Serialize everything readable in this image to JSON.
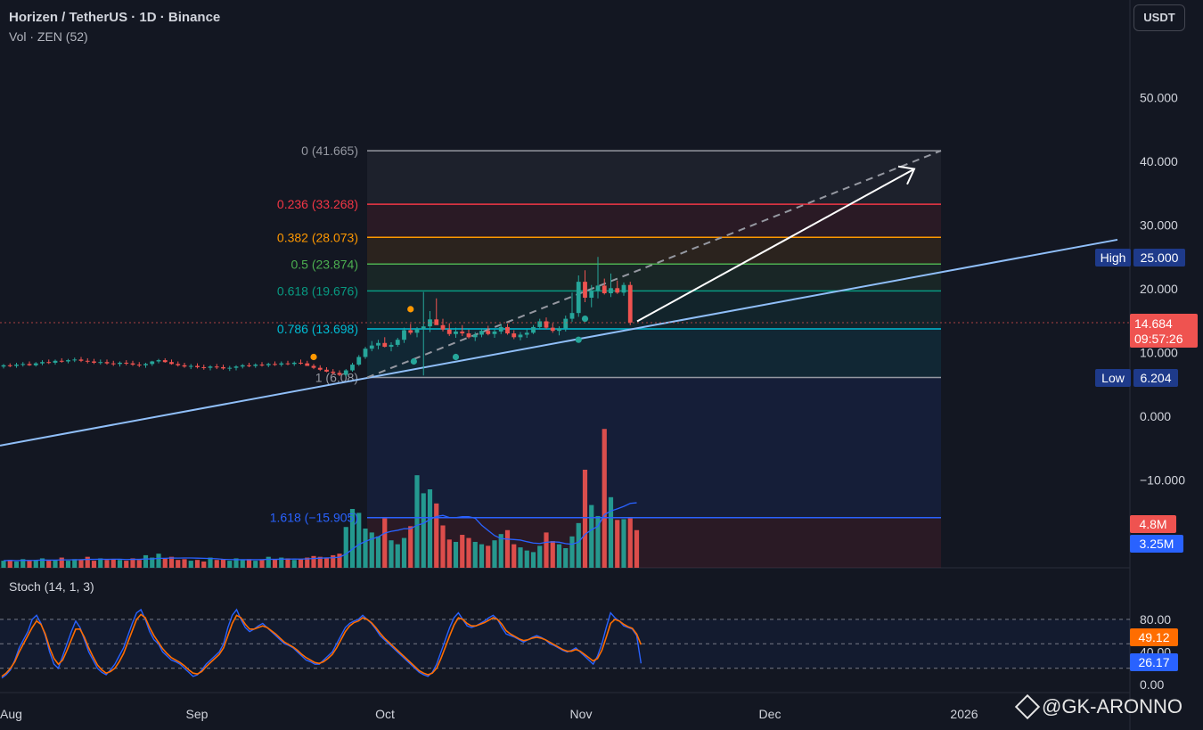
{
  "header": {
    "symbol_title": "Horizen / TetherUS · 1D · Binance",
    "volume_label": "Vol · ZEN (52)"
  },
  "stoch_label": "Stoch (14, 1, 3)",
  "currency_button": "USDT",
  "watermark": "@GK-ARONNO",
  "colors": {
    "background": "#131722",
    "up": "#26a69a",
    "down": "#ef5350",
    "trendline": "#90bff9",
    "fib0": "#9598a1",
    "fib236": "#f23645",
    "fib382": "#ff9800",
    "fib5": "#4caf50",
    "fib618": "#089981",
    "fib786": "#00bcd4",
    "fib1": "#9598a1",
    "fib1618": "#2962ff",
    "stoch_k": "#2962ff",
    "stoch_d": "#ff6d00"
  },
  "chart_data": {
    "type": "candlestick",
    "price_axis": {
      "ticks": [
        "50.000",
        "40.000",
        "30.000",
        "20.000",
        "10.000",
        "0.000",
        "−10.000"
      ],
      "tick_values": [
        50,
        40,
        30,
        20,
        10,
        0,
        -10
      ]
    },
    "time_axis": {
      "labels": [
        "Aug",
        "Sep",
        "Oct",
        "Nov",
        "Dec",
        "2026"
      ]
    },
    "current_price": {
      "value": "14.684",
      "countdown": "09:57:26"
    },
    "high_marker": {
      "label": "High",
      "value": "25.000"
    },
    "low_marker": {
      "label": "Low",
      "value": "6.204"
    },
    "fib_levels": [
      {
        "ratio": "0",
        "price": 41.665,
        "label": "0 (41.665)"
      },
      {
        "ratio": "0.236",
        "price": 33.268,
        "label": "0.236 (33.268)"
      },
      {
        "ratio": "0.382",
        "price": 28.073,
        "label": "0.382 (28.073)"
      },
      {
        "ratio": "0.5",
        "price": 23.874,
        "label": "0.5 (23.874)"
      },
      {
        "ratio": "0.618",
        "price": 19.676,
        "label": "0.618 (19.676)"
      },
      {
        "ratio": "0.786",
        "price": 13.698,
        "label": "0.786 (13.698)"
      },
      {
        "ratio": "1",
        "price": 6.08,
        "label": "1 (6.08)"
      },
      {
        "ratio": "1.618",
        "price": -15.905,
        "label": "1.618 (−15.905)"
      }
    ],
    "volume_labels": {
      "current": "4.8M",
      "average": "3.25M"
    },
    "stoch": {
      "ticks": [
        "80.00",
        "40.00",
        "0.00"
      ],
      "k_value": "26.17",
      "d_value": "49.12",
      "k": [
        8,
        12,
        18,
        30,
        45,
        55,
        65,
        80,
        85,
        75,
        60,
        40,
        25,
        20,
        35,
        50,
        65,
        78,
        70,
        55,
        40,
        30,
        20,
        15,
        12,
        18,
        25,
        35,
        45,
        60,
        75,
        88,
        92,
        80,
        65,
        55,
        50,
        40,
        35,
        30,
        28,
        25,
        20,
        15,
        10,
        12,
        18,
        25,
        30,
        35,
        40,
        50,
        70,
        85,
        92,
        80,
        70,
        65,
        68,
        72,
        75,
        70,
        65,
        60,
        55,
        50,
        48,
        45,
        40,
        35,
        30,
        28,
        25,
        25,
        30,
        35,
        40,
        50,
        60,
        70,
        75,
        78,
        80,
        85,
        80,
        75,
        68,
        60,
        55,
        50,
        45,
        40,
        35,
        30,
        25,
        20,
        15,
        12,
        10,
        15,
        25,
        40,
        55,
        70,
        82,
        88,
        80,
        72,
        70,
        72,
        75,
        78,
        82,
        85,
        80,
        70,
        62,
        60,
        58,
        55,
        52,
        55,
        58,
        60,
        58,
        55,
        50,
        48,
        45,
        42,
        40,
        42,
        45,
        40,
        35,
        30,
        25,
        35,
        50,
        70,
        88,
        82,
        78,
        72,
        70,
        68,
        60,
        26
      ],
      "d": [
        10,
        14,
        20,
        28,
        40,
        50,
        60,
        70,
        78,
        74,
        62,
        45,
        32,
        25,
        30,
        42,
        55,
        68,
        68,
        58,
        45,
        34,
        24,
        18,
        14,
        16,
        20,
        28,
        38,
        52,
        66,
        80,
        86,
        82,
        70,
        60,
        52,
        44,
        38,
        33,
        30,
        27,
        23,
        18,
        14,
        13,
        16,
        22,
        27,
        32,
        37,
        45,
        60,
        75,
        85,
        82,
        74,
        68,
        68,
        70,
        72,
        70,
        66,
        62,
        57,
        52,
        49,
        46,
        42,
        37,
        33,
        30,
        27,
        26,
        28,
        32,
        37,
        45,
        55,
        65,
        72,
        76,
        78,
        82,
        80,
        76,
        70,
        63,
        57,
        52,
        47,
        42,
        37,
        32,
        27,
        22,
        17,
        14,
        12,
        14,
        20,
        32,
        46,
        60,
        73,
        82,
        80,
        75,
        72,
        72,
        74,
        76,
        79,
        82,
        80,
        74,
        66,
        62,
        59,
        56,
        54,
        55,
        57,
        58,
        57,
        55,
        52,
        49,
        46,
        43,
        41,
        41,
        43,
        41,
        37,
        33,
        29,
        32,
        42,
        58,
        75,
        80,
        78,
        74,
        71,
        69,
        62,
        49
      ]
    },
    "candles": [
      [
        7.8,
        8.2,
        7.5,
        8.0
      ],
      [
        8.0,
        8.3,
        7.7,
        7.9
      ],
      [
        7.9,
        8.4,
        7.6,
        8.1
      ],
      [
        8.1,
        8.5,
        7.8,
        8.2
      ],
      [
        8.2,
        8.6,
        7.9,
        8.0
      ],
      [
        8.0,
        8.5,
        7.8,
        8.3
      ],
      [
        8.3,
        8.8,
        8.0,
        8.5
      ],
      [
        8.5,
        8.9,
        8.2,
        8.4
      ],
      [
        8.4,
        8.9,
        8.1,
        8.7
      ],
      [
        8.7,
        9.1,
        8.4,
        8.6
      ],
      [
        8.6,
        9.0,
        8.3,
        8.8
      ],
      [
        8.8,
        9.2,
        8.5,
        8.9
      ],
      [
        8.9,
        9.3,
        8.5,
        8.7
      ],
      [
        8.7,
        9.1,
        8.3,
        8.6
      ],
      [
        8.6,
        9.0,
        8.2,
        8.4
      ],
      [
        8.4,
        8.9,
        8.1,
        8.5
      ],
      [
        8.5,
        8.9,
        8.1,
        8.3
      ],
      [
        8.3,
        8.7,
        7.9,
        8.2
      ],
      [
        8.2,
        8.6,
        7.8,
        8.4
      ],
      [
        8.4,
        8.8,
        8.0,
        8.3
      ],
      [
        8.3,
        8.7,
        7.9,
        8.1
      ],
      [
        8.1,
        8.5,
        7.7,
        8.0
      ],
      [
        8.0,
        8.4,
        7.6,
        8.2
      ],
      [
        8.2,
        8.7,
        7.9,
        8.6
      ],
      [
        8.6,
        9.0,
        8.3,
        8.8
      ],
      [
        8.8,
        9.1,
        8.4,
        8.5
      ],
      [
        8.5,
        8.9,
        8.1,
        8.2
      ],
      [
        8.2,
        8.6,
        7.8,
        8.0
      ],
      [
        8.0,
        8.4,
        7.6,
        7.8
      ],
      [
        7.8,
        8.2,
        7.4,
        7.9
      ],
      [
        7.9,
        8.3,
        7.5,
        7.7
      ],
      [
        7.7,
        8.1,
        7.3,
        7.6
      ],
      [
        7.6,
        8.0,
        7.2,
        7.8
      ],
      [
        7.8,
        8.2,
        7.4,
        7.7
      ],
      [
        7.7,
        8.1,
        7.3,
        7.5
      ],
      [
        7.5,
        7.9,
        7.1,
        7.6
      ],
      [
        7.6,
        8.0,
        7.2,
        7.8
      ],
      [
        7.8,
        8.2,
        7.5,
        8.0
      ],
      [
        8.0,
        8.4,
        7.7,
        7.9
      ],
      [
        7.9,
        8.3,
        7.6,
        8.1
      ],
      [
        8.1,
        8.5,
        7.8,
        8.0
      ],
      [
        8.0,
        8.4,
        7.7,
        8.2
      ],
      [
        8.2,
        8.6,
        7.9,
        8.1
      ],
      [
        8.1,
        8.6,
        7.8,
        8.3
      ],
      [
        8.3,
        8.7,
        8.0,
        8.2
      ],
      [
        8.2,
        8.6,
        7.9,
        8.4
      ],
      [
        8.4,
        8.9,
        8.1,
        8.3
      ],
      [
        8.3,
        8.7,
        7.9,
        7.9
      ],
      [
        7.9,
        8.2,
        7.4,
        7.6
      ],
      [
        7.6,
        8.0,
        7.1,
        7.3
      ],
      [
        7.3,
        7.7,
        6.9,
        7.0
      ],
      [
        7.0,
        7.4,
        6.5,
        6.8
      ],
      [
        6.8,
        7.2,
        6.3,
        6.5
      ],
      [
        6.5,
        7.4,
        6.2,
        7.2
      ],
      [
        7.2,
        8.4,
        7.0,
        8.1
      ],
      [
        8.1,
        9.6,
        7.9,
        9.3
      ],
      [
        9.3,
        10.9,
        9.0,
        10.6
      ],
      [
        10.6,
        11.8,
        10.2,
        11.1
      ],
      [
        11.1,
        12.0,
        10.5,
        11.5
      ],
      [
        11.5,
        12.4,
        10.8,
        10.9
      ],
      [
        10.9,
        11.6,
        10.2,
        11.2
      ],
      [
        11.2,
        12.3,
        10.9,
        12.0
      ],
      [
        12.0,
        13.9,
        11.5,
        13.5
      ],
      [
        13.5,
        14.5,
        12.8,
        13.1
      ],
      [
        13.1,
        14.0,
        12.4,
        13.7
      ],
      [
        13.7,
        19.5,
        6.4,
        14.1
      ],
      [
        14.1,
        16.5,
        13.2,
        15.2
      ],
      [
        15.2,
        18.5,
        14.6,
        14.3
      ],
      [
        14.3,
        15.3,
        13.3,
        13.6
      ],
      [
        13.6,
        14.6,
        12.6,
        12.9
      ],
      [
        12.9,
        13.9,
        12.3,
        13.3
      ],
      [
        13.3,
        14.3,
        12.6,
        13.0
      ],
      [
        13.0,
        13.6,
        12.2,
        12.4
      ],
      [
        12.4,
        13.2,
        11.8,
        12.8
      ],
      [
        12.8,
        13.8,
        12.4,
        13.4
      ],
      [
        13.4,
        14.2,
        12.7,
        12.9
      ],
      [
        12.9,
        13.6,
        12.3,
        13.3
      ],
      [
        13.3,
        14.4,
        12.9,
        14.0
      ],
      [
        14.0,
        14.5,
        12.8,
        13.0
      ],
      [
        13.0,
        13.5,
        12.1,
        12.4
      ],
      [
        12.4,
        13.2,
        11.9,
        12.8
      ],
      [
        12.8,
        13.6,
        12.3,
        13.1
      ],
      [
        13.1,
        14.3,
        12.9,
        14.0
      ],
      [
        14.0,
        15.3,
        13.6,
        14.9
      ],
      [
        14.9,
        15.5,
        13.7,
        13.9
      ],
      [
        13.9,
        14.6,
        13.1,
        13.4
      ],
      [
        13.4,
        14.1,
        12.7,
        13.8
      ],
      [
        13.8,
        15.8,
        13.3,
        15.3
      ],
      [
        15.3,
        19.4,
        14.8,
        16.2
      ],
      [
        16.2,
        22.1,
        15.6,
        21.1
      ],
      [
        21.1,
        22.9,
        17.9,
        18.6
      ],
      [
        18.6,
        20.6,
        17.1,
        19.7
      ],
      [
        19.7,
        25.0,
        18.5,
        20.5
      ],
      [
        20.5,
        21.6,
        19.1,
        19.3
      ],
      [
        19.3,
        22.4,
        18.7,
        20.1
      ],
      [
        20.1,
        21.3,
        19.2,
        19.4
      ],
      [
        19.4,
        21.0,
        18.9,
        20.6
      ],
      [
        20.6,
        21.1,
        14.3,
        14.7
      ]
    ],
    "volumes": [
      0.9,
      1.0,
      0.8,
      1.1,
      0.9,
      1.0,
      1.2,
      0.9,
      1.0,
      1.3,
      0.9,
      1.1,
      1.0,
      1.4,
      0.9,
      1.2,
      1.0,
      1.1,
      1.0,
      0.9,
      1.2,
      1.0,
      1.6,
      1.3,
      1.8,
      1.2,
      1.4,
      1.0,
      1.1,
      0.9,
      1.0,
      0.8,
      1.3,
      1.0,
      1.1,
      0.9,
      1.2,
      1.0,
      1.1,
      0.9,
      1.0,
      1.4,
      1.1,
      1.3,
      1.2,
      1.0,
      1.1,
      1.3,
      1.5,
      1.4,
      1.3,
      1.6,
      1.8,
      5.2,
      7.5,
      7.0,
      5.0,
      4.5,
      4.0,
      6.3,
      3.5,
      3.0,
      3.8,
      5.3,
      11.8,
      9.5,
      10.0,
      8.2,
      5.4,
      3.6,
      3.3,
      4.2,
      3.8,
      3.3,
      3.0,
      2.8,
      3.5,
      4.3,
      4.8,
      3.0,
      2.6,
      2.2,
      2.0,
      2.8,
      4.5,
      3.4,
      3.0,
      2.5,
      4.0,
      5.7,
      12.5,
      8.0,
      6.6,
      17.7,
      9.0,
      6.1,
      6.2,
      6.3,
      4.8
    ]
  }
}
